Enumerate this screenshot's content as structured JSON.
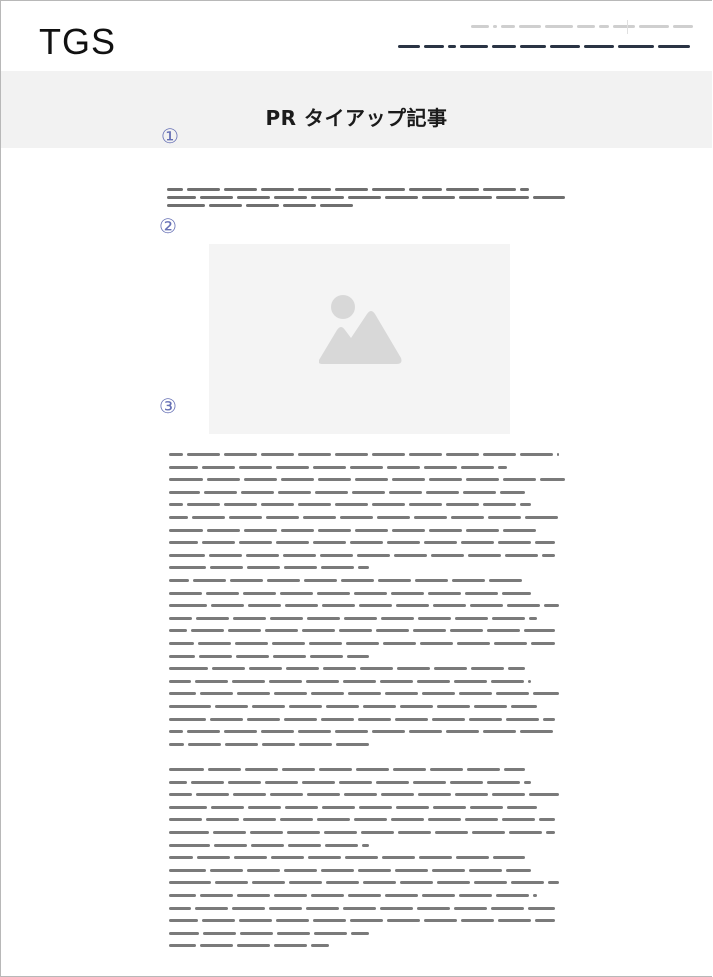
{
  "header": {
    "logo": "TGS"
  },
  "page": {
    "title": "PR タイアップ記事"
  },
  "markers": [
    "①",
    "②",
    "③"
  ],
  "image": {
    "icon": "image-placeholder-icon"
  },
  "colors": {
    "title_band": "#f2f2f2",
    "marker": "#6670b5",
    "nav_dark": "#2a3444",
    "nav_light": "#cfcfcf",
    "text_placeholder": "#7a7a7a"
  }
}
